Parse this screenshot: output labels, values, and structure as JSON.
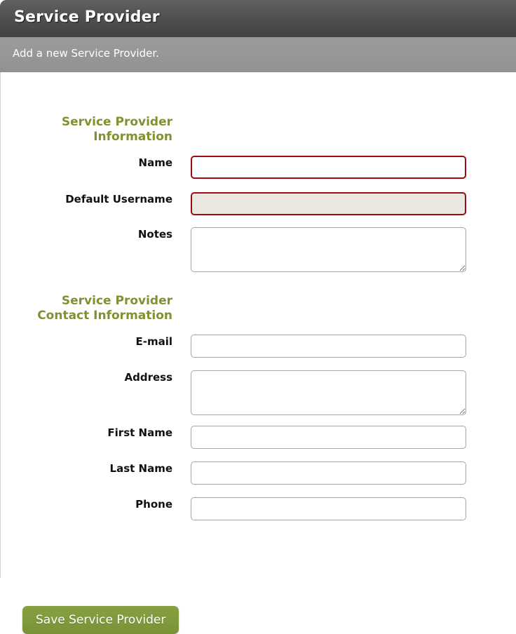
{
  "header": {
    "title": "Service Provider",
    "subtitle": "Add a new Service Provider."
  },
  "colors": {
    "heading_green": "#7d932e",
    "button_green": "#7f9a3c",
    "error_border": "#9c0b10",
    "error_fill": "#e9e7e0",
    "title_bar": "#4b4a4a",
    "subtitle_bar": "#949494"
  },
  "sections": [
    {
      "heading_line1": "Service Provider",
      "heading_line2": "Information",
      "fields": [
        {
          "label": "Name",
          "value": "",
          "placeholder": "",
          "type": "text",
          "state": "error"
        },
        {
          "label": "Default Username",
          "value": "",
          "placeholder": "",
          "type": "text",
          "state": "error-filled"
        },
        {
          "label": "Notes",
          "value": "",
          "placeholder": "",
          "type": "textarea",
          "state": "normal"
        }
      ]
    },
    {
      "heading_line1": "Service Provider",
      "heading_line2": "Contact Information",
      "fields": [
        {
          "label": "E-mail",
          "value": "",
          "placeholder": "",
          "type": "text",
          "state": "normal"
        },
        {
          "label": "Address",
          "value": "",
          "placeholder": "",
          "type": "textarea",
          "state": "normal"
        },
        {
          "label": "First Name",
          "value": "",
          "placeholder": "",
          "type": "text",
          "state": "normal"
        },
        {
          "label": "Last Name",
          "value": "",
          "placeholder": "",
          "type": "text",
          "state": "normal"
        },
        {
          "label": "Phone",
          "value": "",
          "placeholder": "",
          "type": "text",
          "state": "normal"
        }
      ]
    }
  ],
  "actions": {
    "save_label": "Save Service Provider"
  }
}
